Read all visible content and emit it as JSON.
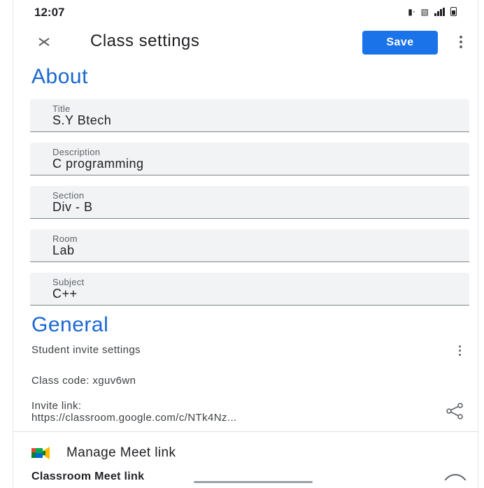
{
  "status_bar": {
    "time": "12:07"
  },
  "app_bar": {
    "title": "Class settings",
    "save_label": "Save"
  },
  "about": {
    "heading": "About",
    "fields": [
      {
        "label": "Title",
        "value": "S.Y Btech"
      },
      {
        "label": "Description",
        "value": "C programming"
      },
      {
        "label": "Section",
        "value": "Div - B"
      },
      {
        "label": "Room",
        "value": "Lab"
      },
      {
        "label": "Subject",
        "value": "C++"
      }
    ]
  },
  "general": {
    "heading": "General",
    "student_invite_settings": "Student invite settings",
    "class_code": "Class code: xguv6wn",
    "invite_link_label": "Invite link:",
    "invite_link_value": "https://classroom.google.com/c/NTk4Nz...",
    "manage_meet_label": "Manage Meet link",
    "classroom_meet_label": "Classroom Meet link"
  },
  "colors": {
    "accent": "#1a73e8",
    "heading": "#1967d2",
    "field_bg": "#f1f3f4"
  },
  "icons": [
    "close-icon",
    "more-vert-icon",
    "share-icon",
    "google-meet-icon"
  ]
}
